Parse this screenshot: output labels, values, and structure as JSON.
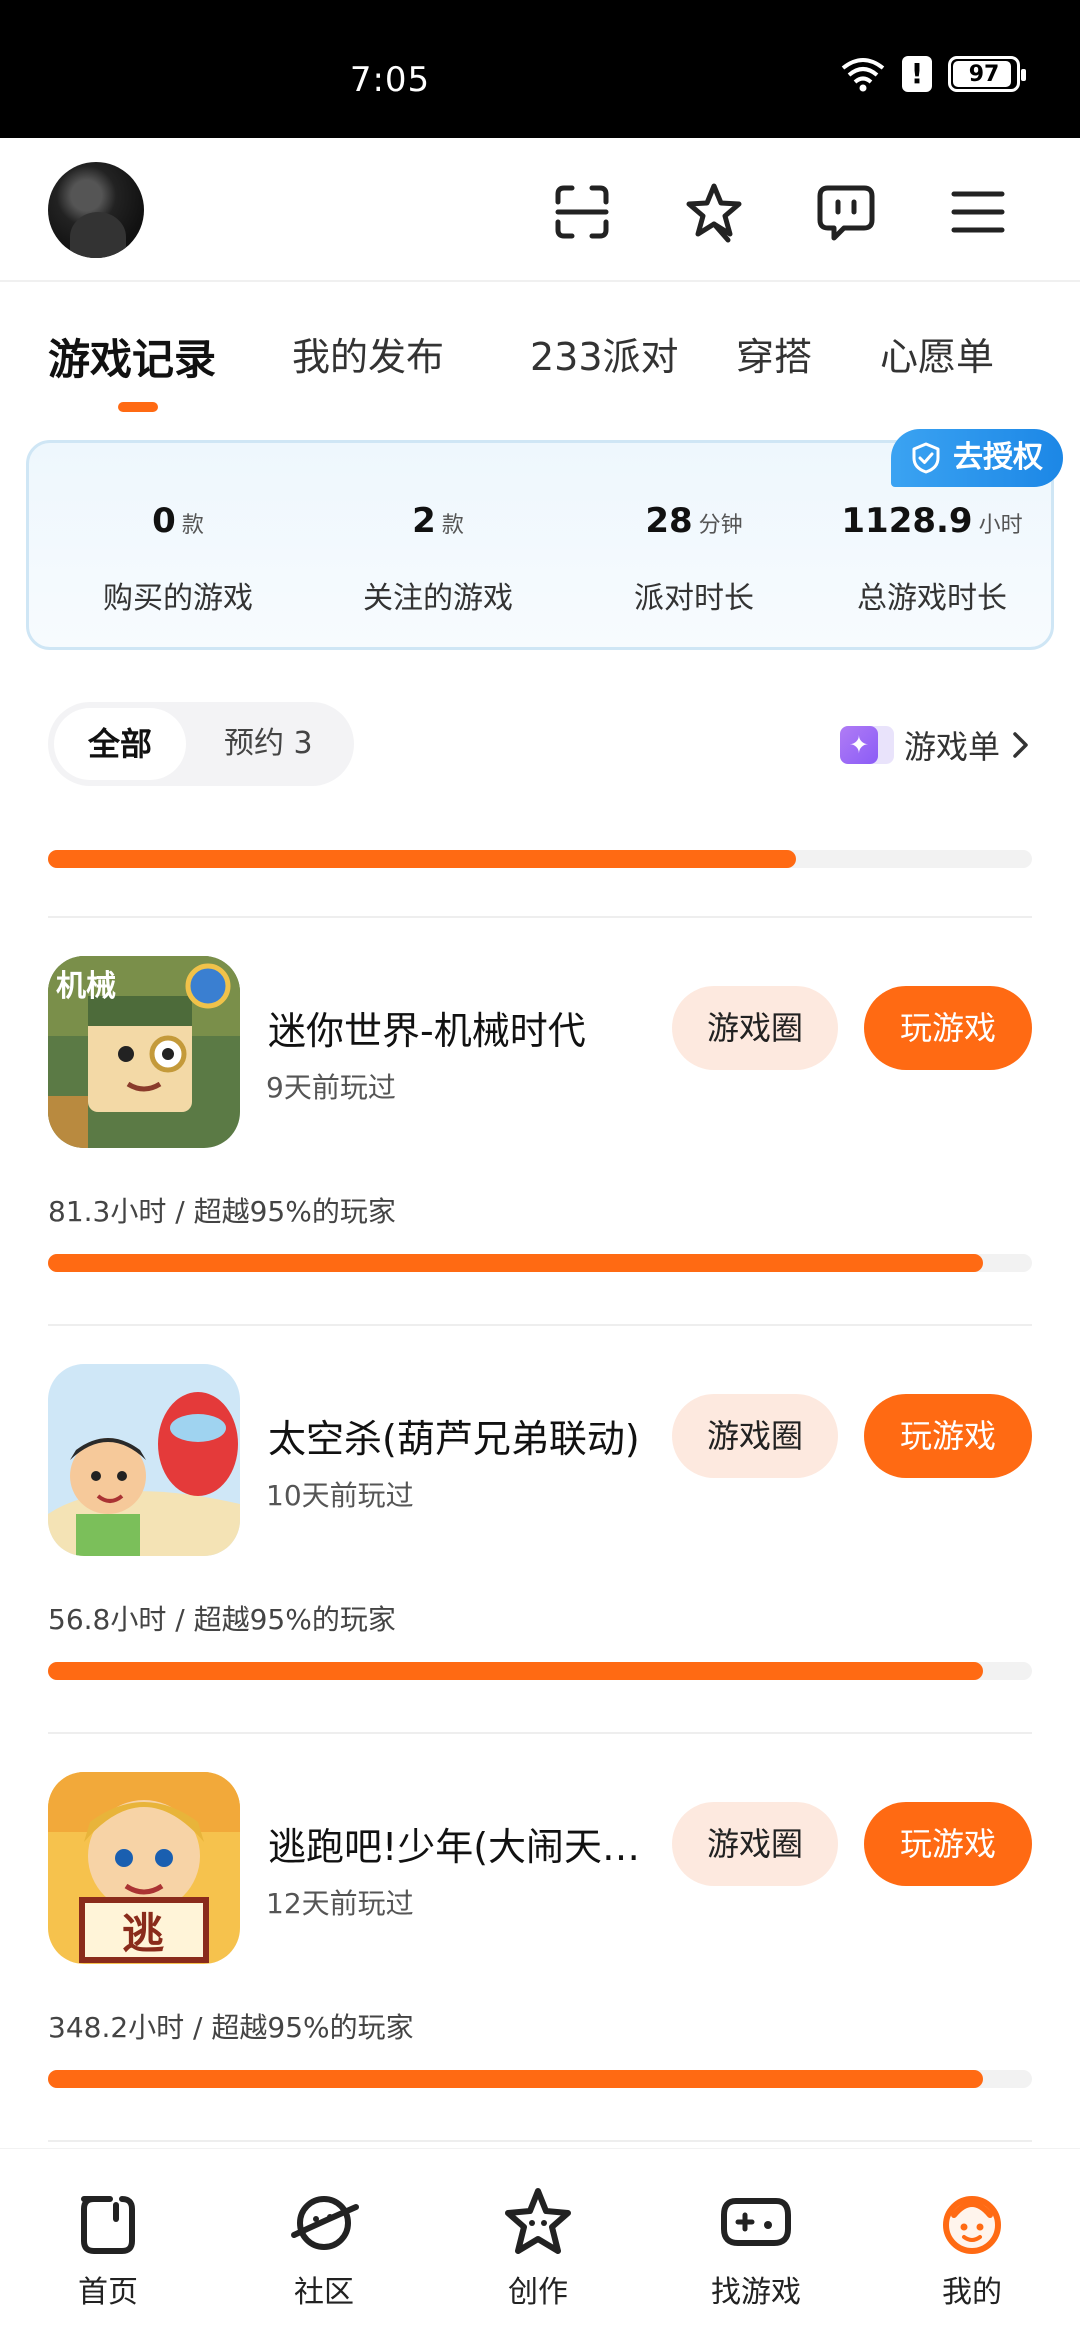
{
  "status_bar": {
    "time": "7:05",
    "battery": "97"
  },
  "header": {
    "icons": [
      "scan-icon",
      "star-icon",
      "message-icon",
      "menu-icon"
    ]
  },
  "tabs": [
    {
      "label": "游戏记录",
      "active": true
    },
    {
      "label": "我的发布"
    },
    {
      "label": "233派对"
    },
    {
      "label": "穿搭"
    },
    {
      "label": "心愿单"
    }
  ],
  "stats": {
    "auth_badge": "去授权",
    "items": [
      {
        "value": "0",
        "unit": "款",
        "label": "购买的游戏"
      },
      {
        "value": "2",
        "unit": "款",
        "label": "关注的游戏"
      },
      {
        "value": "28",
        "unit": "分钟",
        "label": "派对时长"
      },
      {
        "value": "1128.9",
        "unit": "小时",
        "label": "总游戏时长"
      }
    ]
  },
  "filter": {
    "all_label": "全部",
    "reserve_label": "预约 3",
    "game_list_label": "游戏单"
  },
  "partial_row": {
    "progress": 0.76
  },
  "games": [
    {
      "name": "迷你世界-机械时代",
      "played": "9天前玩过",
      "hours": "81.3小时",
      "rank": "超越95%的玩家",
      "stats_text": "81.3小时 / 超越95%的玩家",
      "progress": 0.95,
      "circle_label": "游戏圈",
      "play_label": "玩游戏",
      "icon_label": "机械"
    },
    {
      "name": "太空杀(葫芦兄弟联动)",
      "played": "10天前玩过",
      "hours": "56.8小时",
      "rank": "超越95%的玩家",
      "stats_text": "56.8小时 / 超越95%的玩家",
      "progress": 0.95,
      "circle_label": "游戏圈",
      "play_label": "玩游戏"
    },
    {
      "name": "逃跑吧!少年(大闹天…",
      "played": "12天前玩过",
      "hours": "348.2小时",
      "rank": "超越95%的玩家",
      "stats_text": "348.2小时 / 超越95%的玩家",
      "progress": 0.95,
      "circle_label": "游戏圈",
      "play_label": "玩游戏",
      "icon_label": "逃"
    }
  ],
  "bottom_nav": [
    {
      "label": "首页"
    },
    {
      "label": "社区"
    },
    {
      "label": "创作"
    },
    {
      "label": "找游戏"
    },
    {
      "label": "我的",
      "active": true
    }
  ],
  "colors": {
    "accent": "#ff6a13",
    "auth_blue": "#1c87e6",
    "circle_bg": "#fde9df"
  }
}
